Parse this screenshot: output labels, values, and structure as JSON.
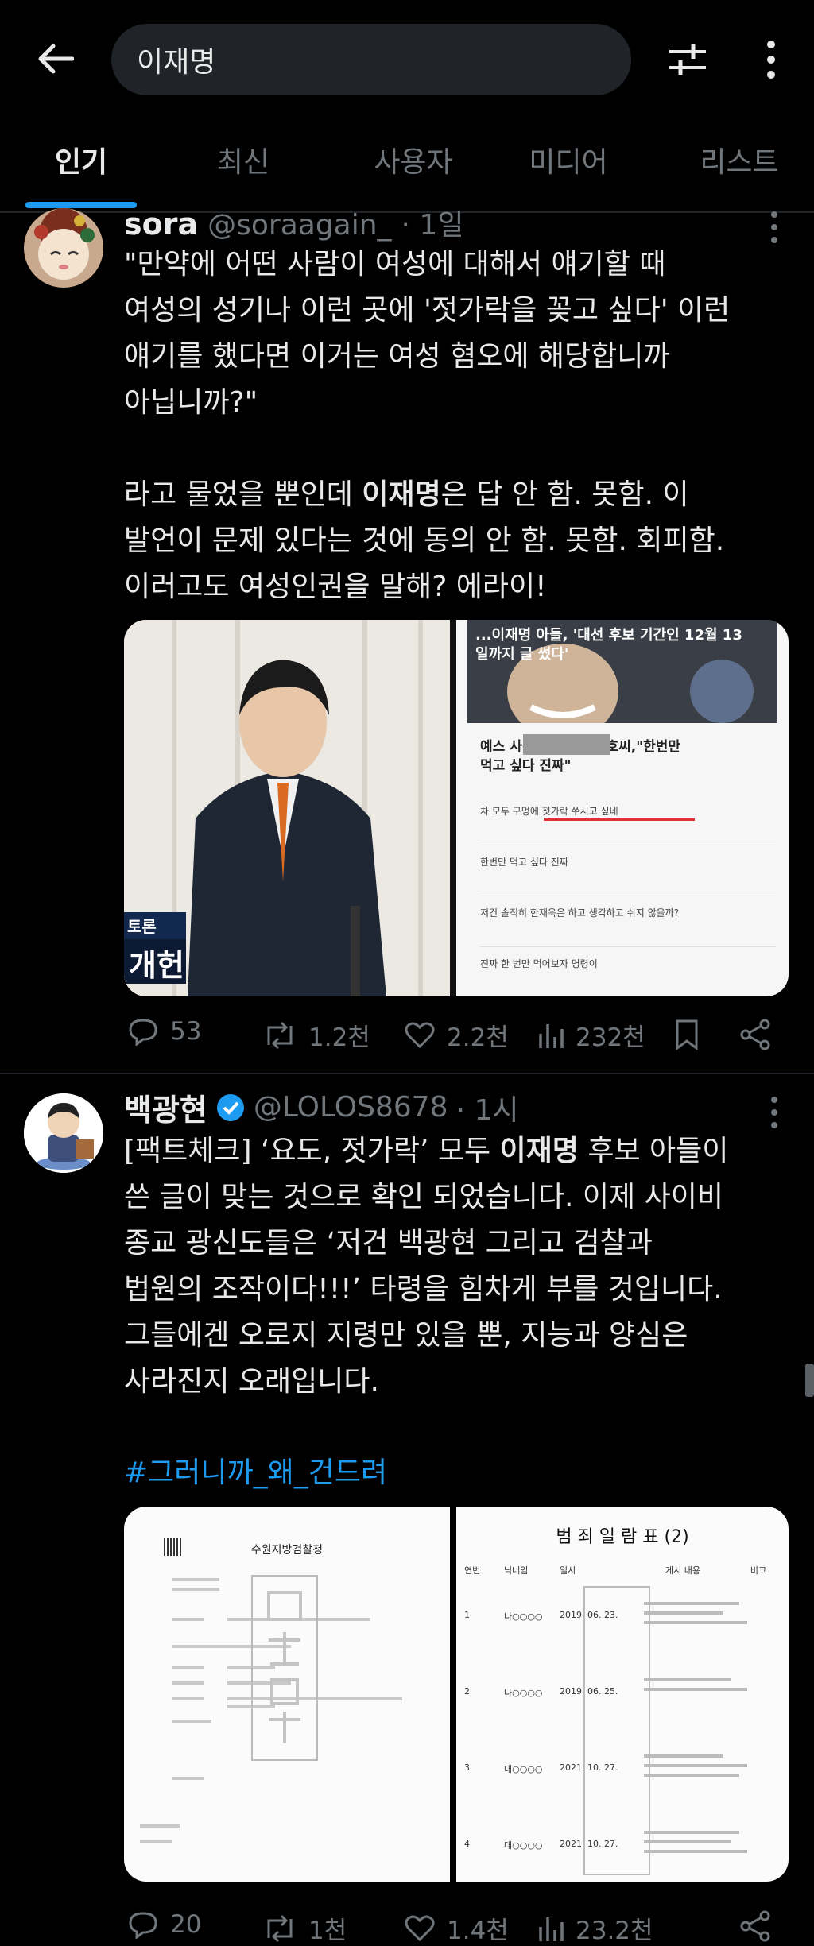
{
  "search": {
    "query": "이재명"
  },
  "tabs": [
    {
      "label": "인기",
      "active": true
    },
    {
      "label": "최신"
    },
    {
      "label": "사용자"
    },
    {
      "label": "미디어"
    },
    {
      "label": "리스트"
    }
  ],
  "tweets": [
    {
      "display_name": "sora",
      "handle": "@soraagain_",
      "time": "· 1일",
      "lines": [
        "\"만약에 어떤 사람이 여성에 대해서 얘기할 때",
        "여성의 성기나 이런 곳에 '젓가락을 꽂고 싶다' 이런",
        "얘기를 했다면 이거는 여성 혐오에 해당합니까",
        "아닙니까?\""
      ],
      "line5_pre": "라고 물었을 뿐인데 ",
      "line5_bold": "이재명",
      "line5_post": "은 답 안 함. 못함. 이",
      "line6": "발언이 문제 있다는 것에 동의 안 함. 못함. 회피함.",
      "line7": "이러고도 여성인권을 말해? 에라이!",
      "media_left_caption": "개헌",
      "media_left_tag": "토론",
      "media_right": {
        "headline1": "...이재명 아들, '대선 후보 기간인 12월 13",
        "headline2": "일까지 글 썼다'",
        "sub_headline1": "예스        사진 올라오자 동호씨,\"한번만",
        "sub_headline2": "먹고 싶다 진짜\"",
        "rows": [
          "차   모두 구멍에 젓가락 쑤시고 싶네",
          "한번만 먹고 싶다 진짜",
          "저건 솔직히 한재욱은 하고 생각하고 쉬지 않을까?",
          "진짜 한 번만 먹어보자 명령이"
        ]
      },
      "actions": {
        "replies": "53",
        "retweets": "1.2천",
        "likes": "2.2천",
        "views": "232천"
      }
    },
    {
      "display_name": "백광현",
      "handle": "@LOLOS8678",
      "time": "· 1시",
      "line1_pre": "[팩트체크] ‘요도, 젓가락’ 모두 ",
      "line1_bold": "이재명",
      "line1_post": " 후보 아들이",
      "lines": [
        "쓴 글이 맞는 것으로 확인 되었습니다. 이제 사이비",
        "종교 광신도들은 ‘저건 백광현 그리고 검찰과",
        "법원의 조작이다!!!’ 타령을 힘차게 부를 것입니다.",
        "그들에겐 오로지 지령만 있을 뿐, 지능과 양심은",
        "사라진지 오래입니다."
      ],
      "hashtag": "#그러니까_왜_건드려",
      "doc_left_title": "수원지방검찰청",
      "doc_right_title": "범 죄 일 람 표 (2)",
      "stamp_text": "무단전재금지",
      "table_headers": [
        "연번",
        "닉네임",
        "일시",
        "게시 내용",
        "비고"
      ],
      "table_rows": [
        {
          "no": "1",
          "nick": "나○○○○",
          "date": "2019. 06. 23."
        },
        {
          "no": "2",
          "nick": "나○○○○",
          "date": "2019. 06. 25."
        },
        {
          "no": "3",
          "nick": "대○○○○",
          "date": "2021. 10. 27."
        },
        {
          "no": "4",
          "nick": "대○○○○",
          "date": "2021. 10. 27."
        }
      ],
      "actions": {
        "replies": "20",
        "retweets": "1천",
        "likes": "1.4천",
        "views": "23.2천"
      }
    }
  ],
  "colors": {
    "accent": "#1d9bf0",
    "background": "#000000",
    "muted": "#71767b"
  }
}
